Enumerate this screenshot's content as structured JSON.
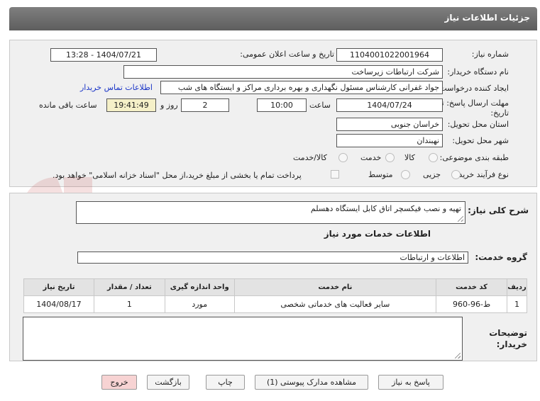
{
  "header": {
    "title": "جزئیات اطلاعات نیاز"
  },
  "form": {
    "need_number": {
      "label": "شماره نیاز:",
      "value": "1104001022001964"
    },
    "announce_datetime": {
      "label": "تاریخ و ساعت اعلان عمومی:",
      "value": "1404/07/21 - 13:28"
    },
    "buyer_org": {
      "label": "نام دستگاه خریدار:",
      "value": "شرکت ارتباطات زیرساخت"
    },
    "requester": {
      "label": "ایجاد کننده درخواست:",
      "value": "جواد غفرانی کارشناس مسئول نگهداری و بهره برداری مراکز و ایستگاه های شب",
      "contact_link": "اطلاعات تماس خریدار"
    },
    "deadline": {
      "label_line1": "مهلت ارسال پاسخ: تا",
      "label_line2": "تاریخ:",
      "date": "1404/07/24",
      "time_label": "ساعت",
      "time": "10:00",
      "days": "2",
      "days_label": "روز و",
      "remaining": "19:41:49",
      "remaining_label": "ساعت باقی مانده"
    },
    "province": {
      "label": "استان محل تحویل:",
      "value": "خراسان جنوبی"
    },
    "city": {
      "label": "شهر محل تحویل:",
      "value": "نهبندان"
    },
    "category": {
      "label": "طبقه بندی موضوعی:",
      "options": [
        "کالا",
        "خدمت",
        "کالا/خدمت"
      ]
    },
    "purchase_type": {
      "label": "نوع فرآیند خرید :",
      "options": [
        "جزیی",
        "متوسط"
      ],
      "payment_note": "پرداخت تمام یا بخشی از مبلغ خرید،از محل \"اسناد خزانه اسلامی\" خواهد بود."
    }
  },
  "details": {
    "summary_label": "شرح کلی نیاز:",
    "summary": "تهیه و نصب فیکسچر اتاق کابل ایستگاه دهسلم",
    "services_title": "اطلاعات خدمات مورد نیاز",
    "service_group_label": "گروه خدمت:",
    "service_group": "اطلاعات و ارتباطات",
    "table": {
      "headers": [
        "ردیف",
        "کد خدمت",
        "نام خدمت",
        "واحد اندازه گیری",
        "تعداد / مقدار",
        "تاریخ نیاز"
      ],
      "rows": [
        [
          "1",
          "ط-96-960",
          "سایر فعالیت های خدماتی شخصی",
          "مورد",
          "1",
          "1404/08/17"
        ]
      ]
    },
    "buyer_notes_label_1": "توضیحات",
    "buyer_notes_label_2": "خریدار:",
    "buyer_notes": ""
  },
  "buttons": {
    "reply": "پاسخ به نیاز",
    "attachments": "مشاهده مدارک پیوستی (1)",
    "print": "چاپ",
    "back": "بازگشت",
    "exit": "خروج"
  },
  "colors": {
    "titlebar": "#6f6f6f",
    "link": "#1a35c7",
    "highlight": "#f5f0c8",
    "exit_button": "#f7d3d3"
  }
}
